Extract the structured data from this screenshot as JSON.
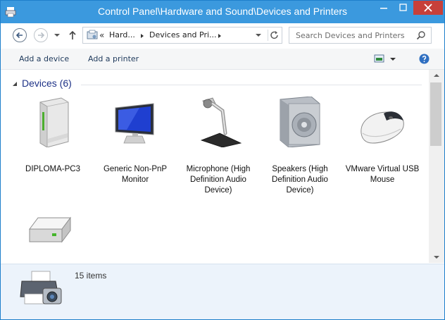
{
  "window": {
    "title": "Control Panel\\Hardware and Sound\\Devices and Printers"
  },
  "address": {
    "overflow": "«",
    "segment1": "Hard...",
    "segment2": "Devices and Pri..."
  },
  "search": {
    "placeholder": "Search Devices and Printers"
  },
  "toolbar": {
    "add_device": "Add a device",
    "add_printer": "Add a printer"
  },
  "devices_group": {
    "title": "Devices (6)",
    "items": [
      {
        "label": "DIPLOMA-PC3",
        "icon": "computer-tower-icon"
      },
      {
        "label": "Generic Non-PnP Monitor",
        "icon": "monitor-icon"
      },
      {
        "label": "Microphone (High Definition Audio Device)",
        "icon": "microphone-icon"
      },
      {
        "label": "Speakers (High Definition Audio Device)",
        "icon": "speakers-icon"
      },
      {
        "label": "VMware Virtual USB Mouse",
        "icon": "mouse-icon"
      },
      {
        "label": "",
        "icon": "hard-drive-icon"
      }
    ]
  },
  "status": {
    "count": "15 items"
  },
  "colors": {
    "titlebar": "#3b99de",
    "close": "#c7403a",
    "group_title": "#1e3287",
    "status_bg": "#ecf3fb"
  }
}
